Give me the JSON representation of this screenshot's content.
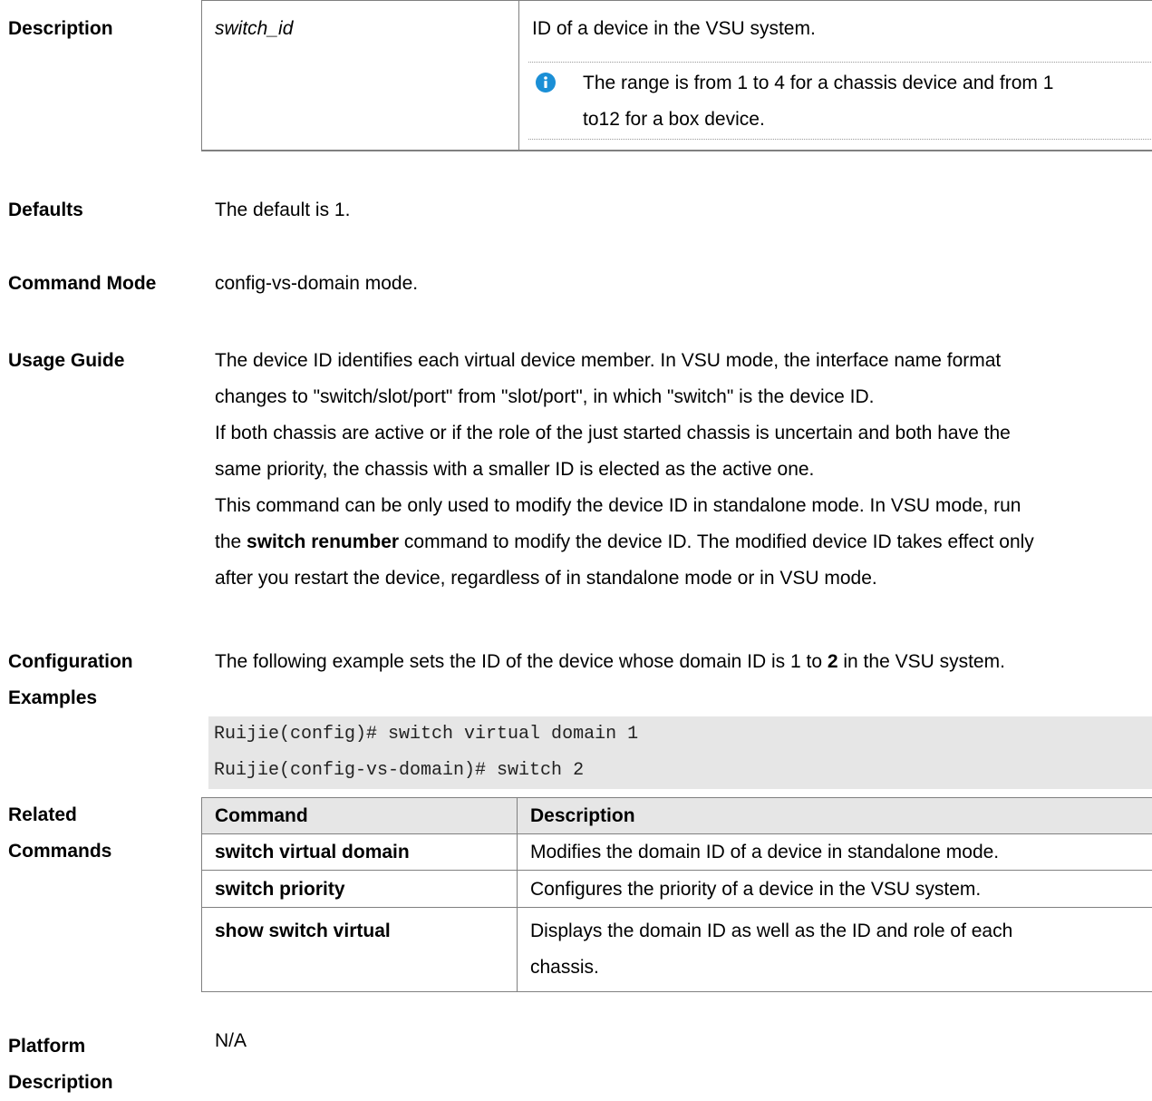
{
  "description_section": {
    "label": "Description",
    "param": "switch_id",
    "param_desc": "ID of a device in the VSU system.",
    "note_icon": "info-icon",
    "note_line1": "The range is from 1 to 4 for a chassis device and from 1",
    "note_line2": "to12 for a box device."
  },
  "defaults": {
    "label": "Defaults",
    "text": "The default is 1."
  },
  "command_mode": {
    "label": "Command Mode",
    "text": "config-vs-domain mode."
  },
  "usage_guide": {
    "label": "Usage Guide",
    "line1": "The device ID identifies each virtual device member. In VSU mode, the interface name format",
    "line2": "changes to \"switch/slot/port\" from \"slot/port\", in which \"switch\" is the device ID.",
    "line3": "If both chassis are active or if the role of the just started chassis is uncertain and both have the",
    "line4": "same priority, the chassis with a smaller ID is elected as the active one.",
    "line5": "This command can be only used to modify the device ID in standalone mode. In VSU mode, run",
    "line6_pre": "the ",
    "line6_bold": "switch renumber",
    "line6_post": " command to modify the device ID. The modified device ID takes effect only",
    "line7": "after you restart the device, regardless of in standalone mode or in VSU mode."
  },
  "config_examples": {
    "label1": "Configuration",
    "label2": "Examples",
    "intro_pre": "The following example sets the ID of the device whose domain ID is 1 to ",
    "intro_bold": "2",
    "intro_post": " in the VSU system.",
    "code_line1": "Ruijie(config)# switch virtual domain 1",
    "code_line2": "Ruijie(config-vs-domain)# switch 2"
  },
  "related_commands": {
    "label1": "Related",
    "label2": "Commands",
    "header_command": "Command",
    "header_description": "Description",
    "rows": [
      {
        "command": "switch virtual domain",
        "description": "Modifies the domain ID of a device in standalone mode."
      },
      {
        "command": "switch priority",
        "description": "Configures the priority of a device in the VSU system."
      },
      {
        "command": "show switch virtual",
        "description_line1": "Displays the domain ID as well as the ID and role of each",
        "description_line2": "chassis."
      }
    ]
  },
  "platform": {
    "label1": "Platform",
    "label2": "Description",
    "text": "N/A"
  }
}
